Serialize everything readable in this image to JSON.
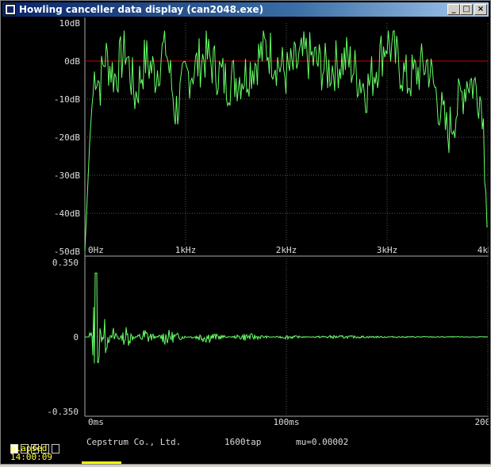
{
  "window": {
    "title": "Howling canceller data display (can2048.exe)",
    "controls": {
      "minimize": "_",
      "maximize": "□",
      "close": "×"
    }
  },
  "spectrum": {
    "y_ticks": [
      "10dB",
      "0dB",
      "-10dB",
      "-20dB",
      "-30dB",
      "-40dB",
      "-50dB"
    ],
    "x_ticks": [
      "0Hz",
      "1kHz",
      "2kHz",
      "3kHz",
      "4kHz"
    ],
    "reference_color": "#cc0000",
    "trace_color": "#66ff66"
  },
  "impulse": {
    "y_ticks": [
      "0.350",
      "0",
      "-0.350"
    ],
    "x_ticks": [
      "0ms",
      "100ms",
      "200ms"
    ],
    "trace_color": "#66ff66"
  },
  "chart_data": [
    {
      "type": "line",
      "xlabel": "",
      "ylabel": "",
      "x_range_hz": [
        0,
        4000
      ],
      "ylim": [
        -50,
        10
      ],
      "reference_line_db": 0,
      "grid": true,
      "x": [
        0,
        50,
        100,
        150,
        200,
        300,
        400,
        500,
        600,
        700,
        800,
        900,
        1000,
        1200,
        1400,
        1600,
        1800,
        2000,
        2200,
        2400,
        2600,
        2800,
        3000,
        3200,
        3400,
        3600,
        3800,
        3900,
        3950,
        4000
      ],
      "y": [
        -50,
        -20,
        0,
        -5,
        3,
        -3,
        5,
        -8,
        2,
        -2,
        6,
        -12,
        -3,
        3,
        -4,
        -2,
        5,
        -2,
        3,
        -1,
        2,
        -6,
        7,
        -4,
        1,
        -18,
        -3,
        -6,
        -10,
        -50
      ]
    },
    {
      "type": "line",
      "xlabel": "",
      "ylabel": "",
      "x_range_ms": [
        0,
        200
      ],
      "ylim": [
        -0.35,
        0.35
      ],
      "grid": true,
      "x": [
        0,
        3,
        5,
        7,
        10,
        15,
        20,
        30,
        40,
        60,
        80,
        100,
        120,
        150,
        200
      ],
      "y": [
        0,
        -0.05,
        0.3,
        -0.12,
        0.1,
        -0.08,
        0.06,
        -0.05,
        0.04,
        -0.03,
        0.02,
        -0.01,
        0.008,
        0.003,
        0.001
      ]
    }
  ],
  "status": {
    "channel_indicators": [
      "",
      "",
      "6",
      "",
      ""
    ],
    "elapsed_label": "elapsed",
    "elapsed_time": "14:00:09",
    "company": "Cepstrum Co., Ltd.",
    "taps": "1600tap",
    "mu": "mu=0.00002"
  }
}
